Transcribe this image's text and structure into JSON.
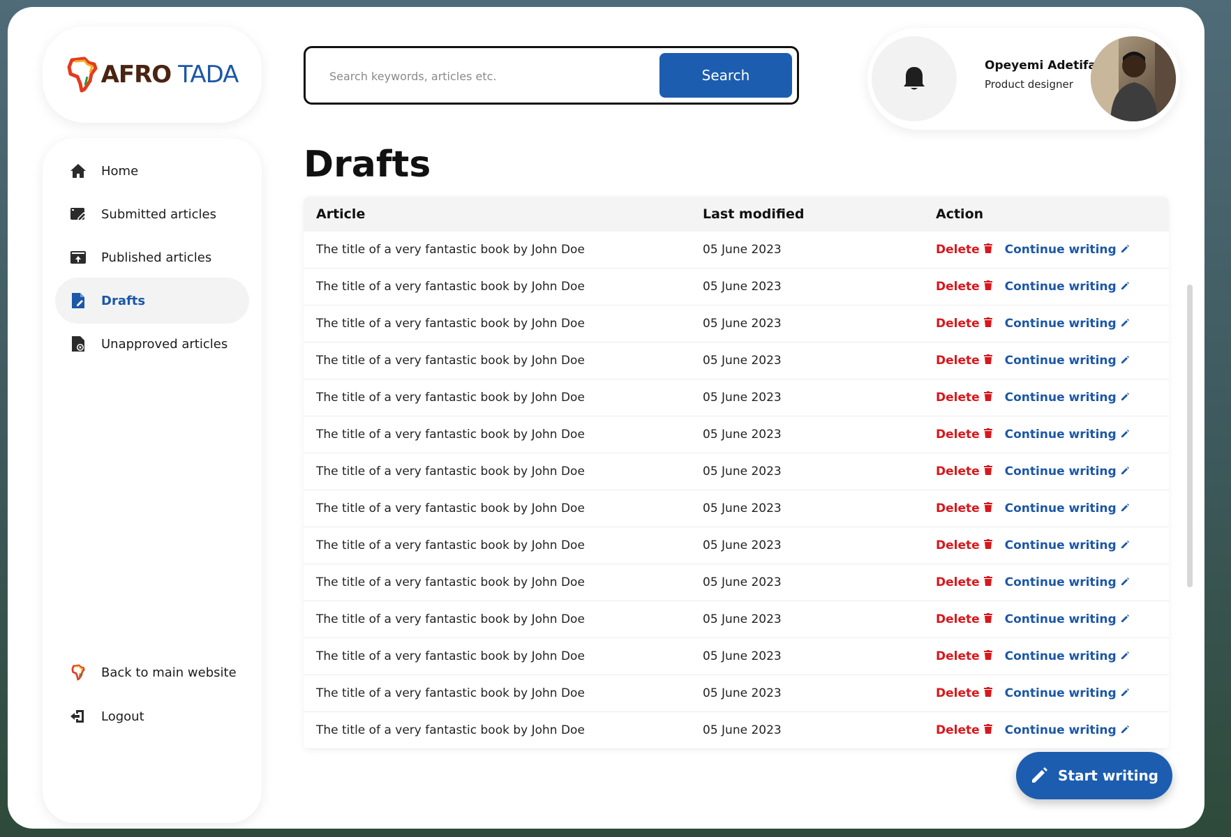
{
  "brand": {
    "name_part1": "AFRO",
    "name_part2": "TADA",
    "colors": {
      "brown": "#4a2412",
      "blue": "#1c57a8"
    }
  },
  "search": {
    "placeholder": "Search keywords, articles etc.",
    "button_label": "Search"
  },
  "profile": {
    "name": "Opeyemi Adetifa",
    "role": "Product designer",
    "notification_icon": "bell-icon"
  },
  "sidebar": {
    "items": [
      {
        "label": "Home",
        "icon": "home-icon",
        "active": false
      },
      {
        "label": "Submitted articles",
        "icon": "submitted-icon",
        "active": false
      },
      {
        "label": "Published articles",
        "icon": "published-icon",
        "active": false
      },
      {
        "label": "Drafts",
        "icon": "drafts-icon",
        "active": true
      },
      {
        "label": "Unapproved articles",
        "icon": "unapproved-icon",
        "active": false
      }
    ],
    "bottom_items": [
      {
        "label": "Back to main website",
        "icon": "africa-logo-icon"
      },
      {
        "label": "Logout",
        "icon": "logout-icon"
      }
    ]
  },
  "page": {
    "title": "Drafts"
  },
  "table": {
    "headers": {
      "article": "Article",
      "last_modified": "Last modified",
      "action": "Action"
    },
    "delete_label": "Delete",
    "continue_label": "Continue writing",
    "rows": [
      {
        "article": "The title of  a very fantastic book by John Doe",
        "date": "05 June 2023"
      },
      {
        "article": "The title of  a very fantastic book by John Doe",
        "date": "05 June 2023"
      },
      {
        "article": "The title of  a very fantastic book by John Doe",
        "date": "05 June 2023"
      },
      {
        "article": "The title of  a very fantastic book by John Doe",
        "date": "05 June 2023"
      },
      {
        "article": "The title of  a very fantastic book by John Doe",
        "date": "05 June 2023"
      },
      {
        "article": "The title of  a very fantastic book by John Doe",
        "date": "05 June 2023"
      },
      {
        "article": "The title of  a very fantastic book by John Doe",
        "date": "05 June 2023"
      },
      {
        "article": "The title of  a very fantastic book by John Doe",
        "date": "05 June 2023"
      },
      {
        "article": "The title of  a very fantastic book by John Doe",
        "date": "05 June 2023"
      },
      {
        "article": "The title of  a very fantastic book by John Doe",
        "date": "05 June 2023"
      },
      {
        "article": "The title of  a very fantastic book by John Doe",
        "date": "05 June 2023"
      },
      {
        "article": "The title of  a very fantastic book by John Doe",
        "date": "05 June 2023"
      },
      {
        "article": "The title of  a very fantastic book by John Doe",
        "date": "05 June 2023"
      },
      {
        "article": "The title of  a very fantastic book by John Doe",
        "date": "05 June 2023"
      }
    ]
  },
  "fab": {
    "label": "Start writing",
    "icon": "pencil-icon"
  },
  "colors": {
    "primary": "#1c5db0",
    "danger": "#d8171c",
    "active_bg": "#f3f3f3"
  }
}
